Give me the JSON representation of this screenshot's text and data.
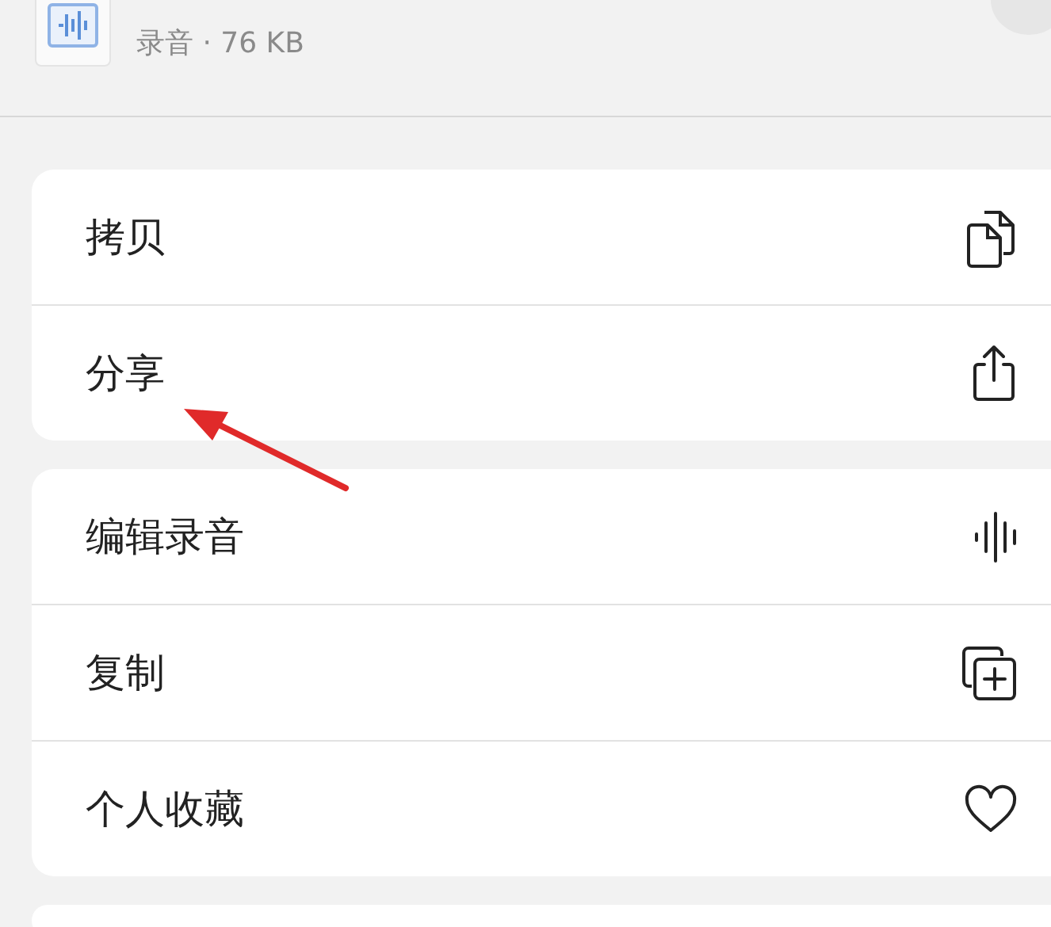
{
  "header": {
    "subtitle": "录音 · 76 KB"
  },
  "groups": [
    {
      "items": [
        {
          "label": "拷贝",
          "kind": "copy"
        },
        {
          "label": "分享",
          "kind": "share"
        }
      ]
    },
    {
      "items": [
        {
          "label": "编辑录音",
          "kind": "waveform"
        },
        {
          "label": "复制",
          "kind": "duplicate"
        },
        {
          "label": "个人收藏",
          "kind": "heart"
        }
      ]
    }
  ]
}
